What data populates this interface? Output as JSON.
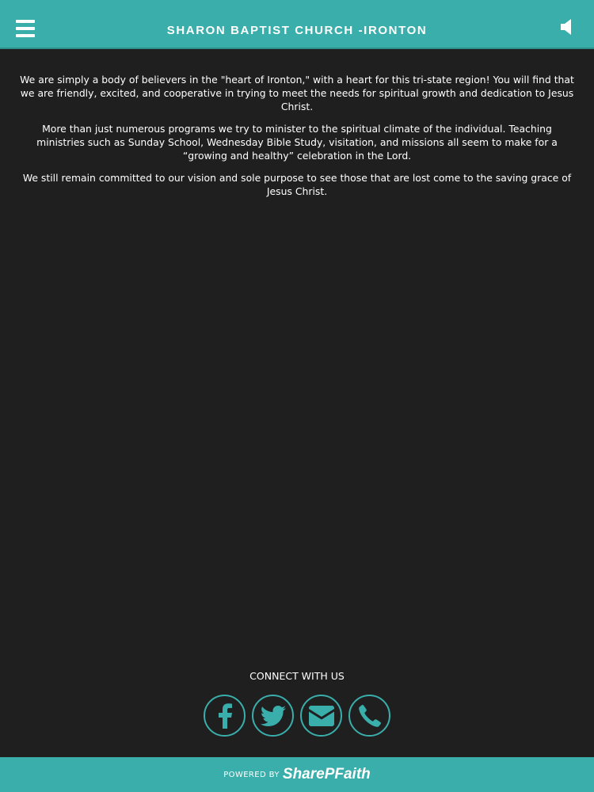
{
  "header": {
    "title": "SHARON BAPTIST CHURCH -IRONTON",
    "menu_icon": "hamburger-menu-icon",
    "audio_icon": "speaker-icon"
  },
  "content": {
    "paragraphs": [
      "We are simply a body of believers in the \"heart of Ironton,\" with a heart for this tri-state region! You will find that we are friendly, excited, and cooperative in trying to meet the needs for spiritual growth and dedication to Jesus Christ.",
      "More than just numerous programs we try to minister to the spiritual climate of the individual. Teaching ministries such as Sunday School, Wednesday Bible Study, visitation, and missions all seem to make for a “growing and healthy” celebration in the Lord.",
      "We still remain committed to our vision and sole purpose to see those that are lost come to the saving grace of Jesus Christ."
    ]
  },
  "connect": {
    "label": "CONNECT WITH US",
    "icons": [
      "facebook-icon",
      "twitter-icon",
      "email-icon",
      "phone-icon"
    ]
  },
  "footer": {
    "powered_by": "POWERED BY",
    "brand": "SharePFaith"
  },
  "colors": {
    "accent": "#3aaeaa",
    "background": "#1f1f20",
    "text": "#ffffff"
  }
}
